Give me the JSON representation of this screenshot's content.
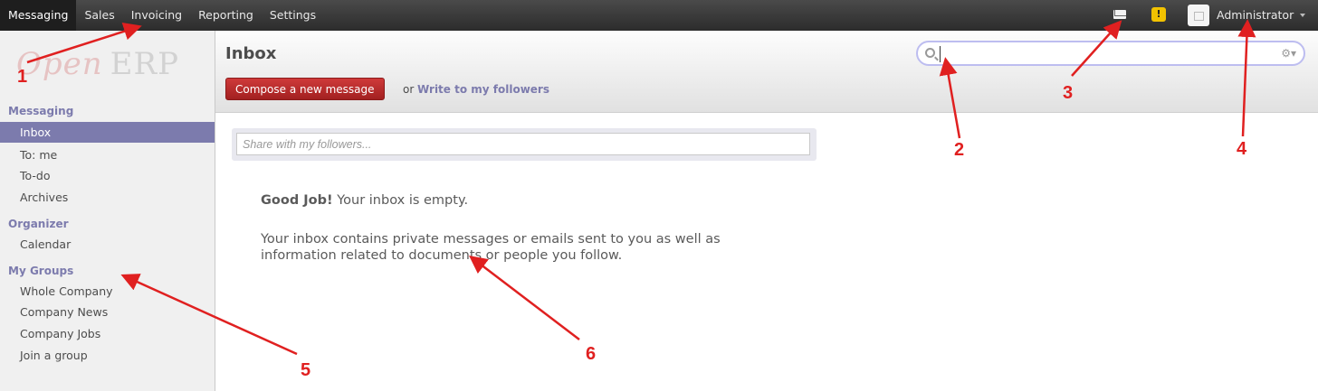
{
  "topbar": {
    "menu": [
      "Messaging",
      "Sales",
      "Invoicing",
      "Reporting",
      "Settings"
    ],
    "user_name": "Administrator",
    "icons": [
      "mail-icon",
      "alert-icon",
      "avatar"
    ]
  },
  "sidebar": {
    "logo_open": "Open",
    "logo_erp": "ERP",
    "sections": [
      {
        "title": "Messaging",
        "items": [
          "Inbox",
          "To: me",
          "To-do",
          "Archives"
        ]
      },
      {
        "title": "Organizer",
        "items": [
          "Calendar"
        ]
      },
      {
        "title": "My Groups",
        "items": [
          "Whole Company",
          "Company News",
          "Company Jobs",
          "Join a group"
        ]
      }
    ],
    "active_item": "Inbox"
  },
  "header": {
    "title": "Inbox",
    "compose_label": "Compose a new message",
    "or_text": "or",
    "write_link": "Write to my followers",
    "search_value": ""
  },
  "content": {
    "share_placeholder": "Share with my followers...",
    "empty_title_bold": "Good Job!",
    "empty_title_rest": " Your inbox is empty.",
    "empty_desc": "Your inbox contains private messages or emails sent to you as well as information related to documents or people you follow."
  },
  "annotations": [
    "1",
    "2",
    "3",
    "4",
    "5",
    "6"
  ],
  "colors": {
    "accent": "#7c7bad",
    "compose": "#b42a2a",
    "annotation": "#e02020"
  }
}
